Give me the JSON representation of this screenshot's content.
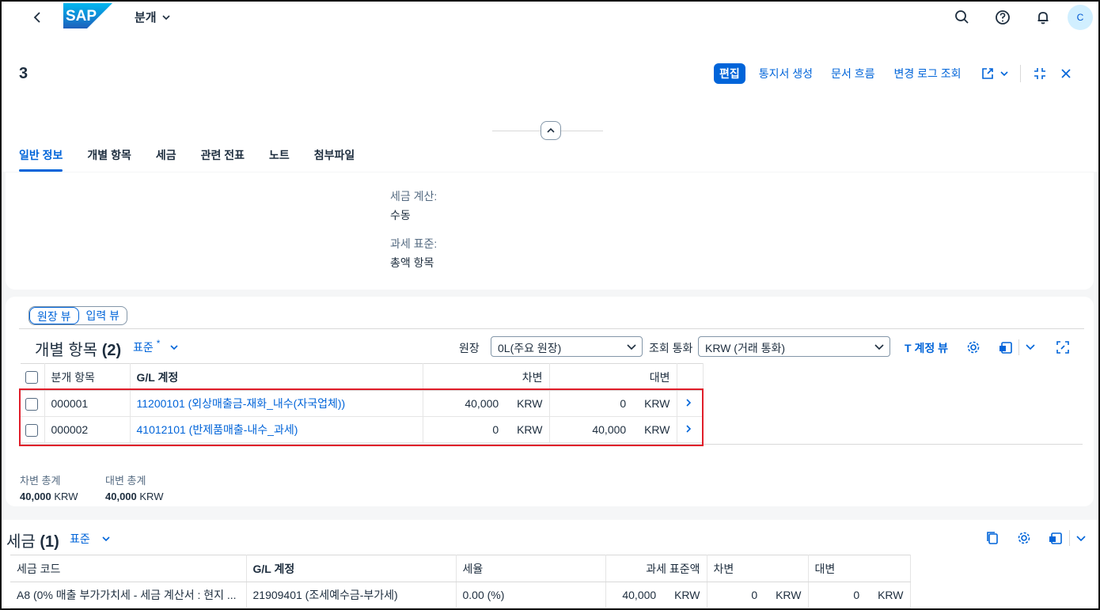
{
  "shell": {
    "app_title": "분개",
    "avatar_initial": "C",
    "icons": [
      "back-icon",
      "search-icon",
      "help-icon",
      "bell-icon"
    ]
  },
  "header": {
    "object_title": "3",
    "actions": {
      "edit": "편집",
      "create_notice": "통지서 생성",
      "document_flow": "문서 흐름",
      "change_log": "변경 로그 조회"
    }
  },
  "tabs": [
    {
      "label": "일반 정보",
      "active": true
    },
    {
      "label": "개별 항목",
      "active": false
    },
    {
      "label": "세금",
      "active": false
    },
    {
      "label": "관련 전표",
      "active": false
    },
    {
      "label": "노트",
      "active": false
    },
    {
      "label": "첨부파일",
      "active": false
    }
  ],
  "general": {
    "tax_calc_label": "세금 계산:",
    "tax_calc_value": "수동",
    "tax_base_label": "과세 표준:",
    "tax_base_value": "총액 항목"
  },
  "items": {
    "view_toggle": {
      "ledger": "원장 뷰",
      "entry": "입력 뷰"
    },
    "title": "개별 항목",
    "count": "(2)",
    "variant": "표준",
    "variant_modified": "*",
    "ledger_label": "원장",
    "ledger_value": "0L(주요 원장)",
    "currency_label": "조회 통화",
    "currency_value": "KRW (거래 통화)",
    "t_account_view": "T 계정 뷰",
    "columns": {
      "item": "분개 항목",
      "gl": "G/L 계정",
      "debit": "차변",
      "credit": "대변"
    },
    "rows": [
      {
        "item": "000001",
        "gl": "11200101 (외상매출금-재화_내수(자국업체))",
        "debit": "40,000",
        "debit_cur": "KRW",
        "credit": "0",
        "credit_cur": "KRW"
      },
      {
        "item": "000002",
        "gl": "41012101 (반제품매출-내수_과세)",
        "debit": "0",
        "debit_cur": "KRW",
        "credit": "40,000",
        "credit_cur": "KRW"
      }
    ],
    "totals": {
      "debit_label": "차변 총계",
      "debit_value": "40,000",
      "debit_cur": "KRW",
      "credit_label": "대변 총계",
      "credit_value": "40,000",
      "credit_cur": "KRW"
    }
  },
  "tax": {
    "title": "세금",
    "count": "(1)",
    "variant": "표준",
    "columns": {
      "tax_code": "세금 코드",
      "gl": "G/L 계정",
      "rate": "세율",
      "base": "과세 표준액",
      "debit": "차변",
      "credit": "대변"
    },
    "rows": [
      {
        "tax_code": "A8 (0% 매출 부가가치세 - 세금 계산서 : 현지 ...",
        "gl": "21909401 (조세예수금-부가세)",
        "rate": "0.00 (%)",
        "base": "40,000",
        "base_cur": "KRW",
        "debit": "0",
        "debit_cur": "KRW",
        "credit": "0",
        "credit_cur": "KRW"
      }
    ]
  },
  "colors": {
    "accent": "#0064d9",
    "highlight": "#e01e2a"
  }
}
